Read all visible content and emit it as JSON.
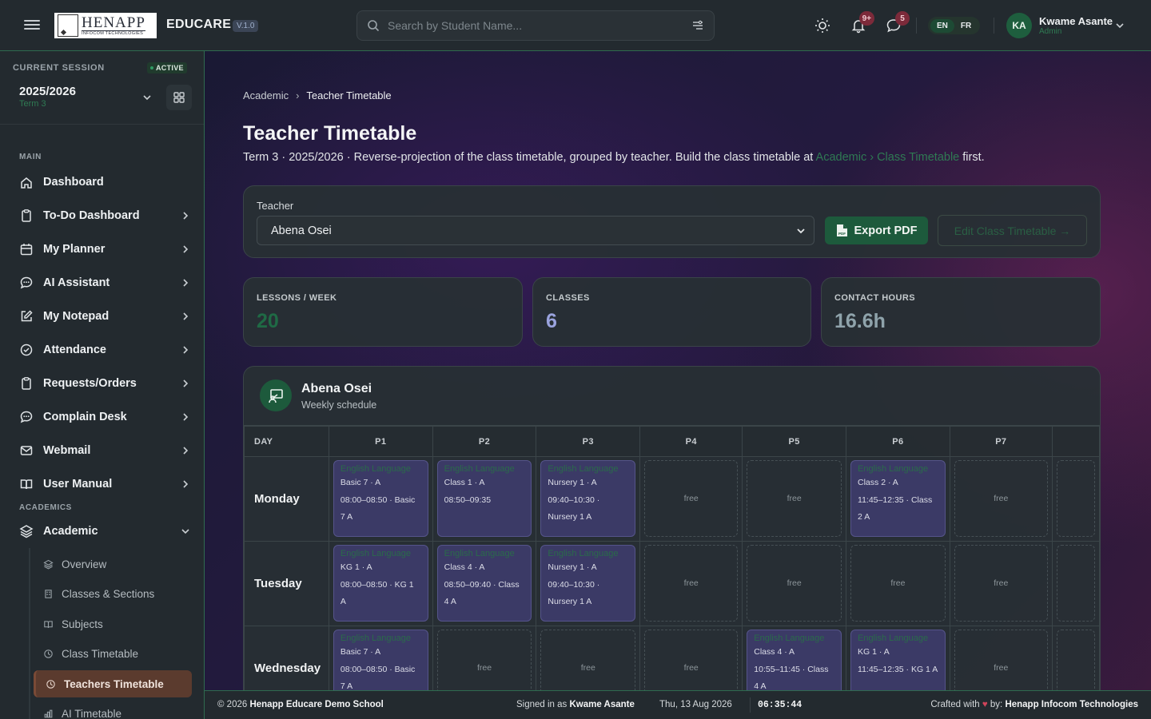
{
  "topbar": {
    "logo_text": "HENAPP",
    "logo_sub": "INFOCOM TECHNOLOGIES",
    "brand": "EDUCARE",
    "version": "V.1.0",
    "search_placeholder": "Search by Student Name...",
    "notifications_badge": "9+",
    "messages_badge": "5",
    "lang_en": "EN",
    "lang_fr": "FR",
    "avatar_initials": "KA",
    "user_name": "Kwame Asante",
    "user_role": "Admin"
  },
  "sidebar": {
    "session_label": "CURRENT SESSION",
    "session_status": "ACTIVE",
    "session_year": "2025/2026",
    "session_term": "Term 3",
    "main_heading": "MAIN",
    "academics_heading": "ACADEMICS",
    "items": [
      {
        "label": "Dashboard",
        "icon": "home-icon"
      },
      {
        "label": "To-Do Dashboard",
        "icon": "clipboard-icon"
      },
      {
        "label": "My Planner",
        "icon": "calendar-icon"
      },
      {
        "label": "AI Assistant",
        "icon": "chat-icon"
      },
      {
        "label": "My Notepad",
        "icon": "edit-icon"
      },
      {
        "label": "Attendance",
        "icon": "check-circle-icon"
      },
      {
        "label": "Requests/Orders",
        "icon": "clipboard-icon"
      },
      {
        "label": "Complain Desk",
        "icon": "chat-icon"
      },
      {
        "label": "Webmail",
        "icon": "mail-icon"
      },
      {
        "label": "User Manual",
        "icon": "book-icon"
      }
    ],
    "academic": {
      "label": "Academic",
      "icon": "layers-icon"
    },
    "academic_sub": [
      {
        "label": "Overview",
        "icon": "layers-icon"
      },
      {
        "label": "Classes & Sections",
        "icon": "building-icon"
      },
      {
        "label": "Subjects",
        "icon": "book-icon"
      },
      {
        "label": "Class Timetable",
        "icon": "clock-icon"
      },
      {
        "label": "Teachers Timetable",
        "icon": "clock-icon"
      },
      {
        "label": "AI Timetable",
        "icon": "chart-icon"
      }
    ]
  },
  "main": {
    "breadcrumb_parent": "Academic",
    "breadcrumb_current": "Teacher Timetable",
    "title": "Teacher Timetable",
    "desc_prefix": "Term 3 · 2025/2026 · Reverse-projection of the class timetable, grouped by teacher. Build the class timetable at ",
    "desc_link": "Academic › Class Timetable",
    "desc_suffix": " first.",
    "teacher_label": "Teacher",
    "teacher_value": "Abena Osei",
    "export_label": "Export PDF",
    "edit_label": "Edit Class Timetable →",
    "stats": [
      {
        "label": "LESSONS / WEEK",
        "value": "20",
        "color": "#1f6a45"
      },
      {
        "label": "CLASSES",
        "value": "6",
        "color": "#9aa3de"
      },
      {
        "label": "CONTACT HOURS",
        "value": "16.6h",
        "color": "#8fa3ab"
      }
    ],
    "schedule_name": "Abena Osei",
    "schedule_sub": "Weekly schedule",
    "day_header": "DAY",
    "periods": [
      "P1",
      "P2",
      "P3",
      "P4",
      "P5",
      "P6",
      "P7"
    ],
    "free_label": "free",
    "days": [
      {
        "name": "Monday",
        "slots": [
          {
            "subject": "English Language",
            "class": "Basic 7 · A",
            "time": "08:00–08:50 · Basic 7 A"
          },
          {
            "subject": "English Language",
            "class": "Class 1 · A",
            "time": "08:50–09:35"
          },
          {
            "subject": "English Language",
            "class": "Nursery 1 · A",
            "time": "09:40–10:30 · Nursery 1 A"
          },
          null,
          null,
          {
            "subject": "English Language",
            "class": "Class 2 · A",
            "time": "11:45–12:35 · Class 2 A"
          },
          null
        ]
      },
      {
        "name": "Tuesday",
        "slots": [
          {
            "subject": "English Language",
            "class": "KG 1 · A",
            "time": "08:00–08:50 · KG 1 A"
          },
          {
            "subject": "English Language",
            "class": "Class 4 · A",
            "time": "08:50–09:40 · Class 4 A"
          },
          {
            "subject": "English Language",
            "class": "Nursery 1 · A",
            "time": "09:40–10:30 · Nursery 1 A"
          },
          null,
          null,
          null,
          null
        ]
      },
      {
        "name": "Wednesday",
        "slots": [
          {
            "subject": "English Language",
            "class": "Basic 7 · A",
            "time": "08:00–08:50 · Basic 7 A"
          },
          null,
          null,
          null,
          {
            "subject": "English Language",
            "class": "Class 4 · A",
            "time": "10:55–11:45 · Class 4 A"
          },
          {
            "subject": "English Language",
            "class": "KG 1 · A",
            "time": "11:45–12:35 · KG 1 A"
          },
          null
        ]
      }
    ]
  },
  "footer": {
    "copy_prefix": "© 2026 ",
    "school": "Henapp Educare Demo School",
    "signed_prefix": "Signed in as ",
    "signed_user": "Kwame Asante",
    "date": "Thu, 13 Aug 2026",
    "time": "06:35:44",
    "crafted_prefix": "Crafted with ",
    "crafted_mid": " by: ",
    "crafted_by": "Henapp Infocom Technologies"
  }
}
